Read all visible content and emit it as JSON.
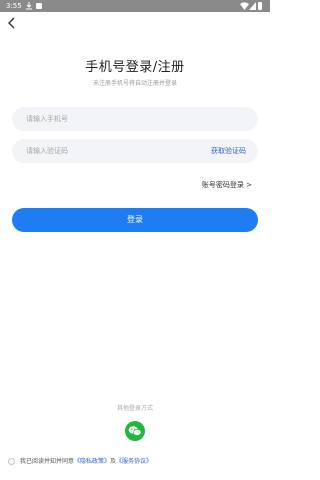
{
  "status_bar": {
    "time": "3:55",
    "icons": [
      "download-icon",
      "image-icon",
      "wifi-icon",
      "signal-icon",
      "battery-icon"
    ]
  },
  "nav": {
    "back_icon": "back-arrow-icon"
  },
  "header": {
    "title": "手机号登录/注册",
    "subtitle": "未注册手机号将自动注册并登录"
  },
  "form": {
    "phone_placeholder": "请输入手机号",
    "code_placeholder": "请输入验证码",
    "get_code_label": "获取验证码",
    "password_login_label": "账号密码登录 >",
    "login_button_label": "登录"
  },
  "other_login": {
    "label": "其他登录方式",
    "wechat_icon": "wechat-icon"
  },
  "agreement": {
    "prefix": "我已阅读并知并同意",
    "privacy_policy": "《隐私政策》",
    "and": "及",
    "service_agreement": "《服务协议》"
  },
  "colors": {
    "accent": "#1e7df2",
    "link": "#2b63d9",
    "field_bg": "#f3f4f7",
    "wechat": "#1fb83d",
    "status_bar": "#8a8a8a"
  }
}
